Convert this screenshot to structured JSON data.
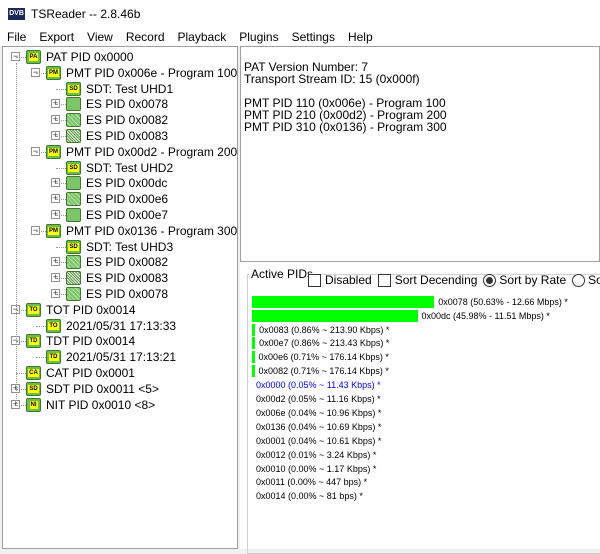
{
  "window": {
    "title": "TSReader -- 2.8.46b",
    "logo": "DVB"
  },
  "menu": [
    "File",
    "Export",
    "View",
    "Record",
    "Playback",
    "Plugins",
    "Settings",
    "Help"
  ],
  "tree": [
    {
      "label": "PAT PID 0x0000",
      "level": 0,
      "exp": "-",
      "icon": "PAT"
    },
    {
      "label": "PMT PID 0x006e - Program 100",
      "level": 1,
      "exp": "-",
      "icon": "PMT"
    },
    {
      "label": "SDT: Test UHD1",
      "level": 2,
      "exp": "",
      "icon": "SDT"
    },
    {
      "label": "ES PID 0x0078",
      "level": 2,
      "exp": "+",
      "icon": "es1"
    },
    {
      "label": "ES PID 0x0082",
      "level": 2,
      "exp": "+",
      "icon": "es2"
    },
    {
      "label": "ES PID 0x0083",
      "level": 2,
      "exp": "+",
      "icon": "es3"
    },
    {
      "label": "PMT PID 0x00d2 - Program 200",
      "level": 1,
      "exp": "-",
      "icon": "PMT"
    },
    {
      "label": "SDT: Test UHD2",
      "level": 2,
      "exp": "",
      "icon": "SDT"
    },
    {
      "label": "ES PID 0x00dc",
      "level": 2,
      "exp": "+",
      "icon": "es1"
    },
    {
      "label": "ES PID 0x00e6",
      "level": 2,
      "exp": "+",
      "icon": "es2"
    },
    {
      "label": "ES PID 0x00e7",
      "level": 2,
      "exp": "+",
      "icon": "es1"
    },
    {
      "label": "PMT PID 0x0136 - Program 300",
      "level": 1,
      "exp": "-",
      "icon": "PMT"
    },
    {
      "label": "SDT: Test UHD3",
      "level": 2,
      "exp": "",
      "icon": "SDT"
    },
    {
      "label": "ES PID 0x0082",
      "level": 2,
      "exp": "+",
      "icon": "es2"
    },
    {
      "label": "ES PID 0x0083",
      "level": 2,
      "exp": "+",
      "icon": "es3"
    },
    {
      "label": "ES PID 0x0078",
      "level": 2,
      "exp": "+",
      "icon": "es2"
    },
    {
      "label": "TOT PID 0x0014",
      "level": 0,
      "exp": "-",
      "icon": "TOT"
    },
    {
      "label": "2021/05/31 17:13:33",
      "level": 1,
      "exp": "",
      "icon": "TOT"
    },
    {
      "label": "TDT PID 0x0014",
      "level": 0,
      "exp": "-",
      "icon": "TDT"
    },
    {
      "label": "2021/05/31 17:13:21",
      "level": 1,
      "exp": "",
      "icon": "TDT"
    },
    {
      "label": "CAT PID 0x0001",
      "level": 0,
      "exp": "",
      "icon": "CAT"
    },
    {
      "label": "SDT PID 0x0011 <5>",
      "level": 0,
      "exp": "+",
      "icon": "SDT"
    },
    {
      "label": "NIT PID 0x0010 <8>",
      "level": 0,
      "exp": "+",
      "icon": "NIT"
    }
  ],
  "info": {
    "lines": [
      "PAT Version Number: 7",
      "Transport Stream ID: 15 (0x000f)",
      "",
      "PMT PID 110 (0x006e) - Program 100",
      "PMT PID 210 (0x00d2) - Program 200",
      "PMT PID 310 (0x0136) - Program 300"
    ]
  },
  "active_pids": {
    "label": "Active PIDs",
    "disabled_label": "Disabled",
    "disabled": false,
    "sort_desc_label": "Sort Decending",
    "sort_desc": false,
    "sort_rate_label": "Sort by Rate",
    "sort_rate": true,
    "sort_other_label": "Sort by",
    "bar_color": "#00ff00",
    "highlight_color": "#0000ff",
    "items": [
      {
        "text": "0x0078 (50.63% - 12.66 Mbps) *",
        "pct": 50.63
      },
      {
        "text": "0x00dc (45.98% - 11.51 Mbps) *",
        "pct": 45.98
      },
      {
        "text": "0x0083 (0.86% ~ 213.90 Kbps) *",
        "pct": 0.86
      },
      {
        "text": "0x00e7 (0.86% ~ 213.43 Kbps) *",
        "pct": 0.86
      },
      {
        "text": "0x00e6 (0.71% ~ 176.14 Kbps) *",
        "pct": 0.71
      },
      {
        "text": "0x0082 (0.71% ~ 176.14 Kbps) *",
        "pct": 0.71
      },
      {
        "text": "0x0000 (0.05% ~ 11.43 Kbps) *",
        "pct": 0.05,
        "highlight": true
      },
      {
        "text": "0x00d2 (0.05% ~ 11.16 Kbps) *",
        "pct": 0.05
      },
      {
        "text": "0x006e (0.04% ~ 10.96 Kbps) *",
        "pct": 0.04
      },
      {
        "text": "0x0136 (0.04% ~ 10.69 Kbps) *",
        "pct": 0.04
      },
      {
        "text": "0x0001 (0.04% ~ 10.61 Kbps) *",
        "pct": 0.04
      },
      {
        "text": "0x0012 (0.01% ~ 3.24 Kbps) *",
        "pct": 0.01
      },
      {
        "text": "0x0010 (0.00% ~ 1.17 Kbps) *",
        "pct": 0.0
      },
      {
        "text": "0x0011 (0.00% ~ 447 bps) *",
        "pct": 0.0
      },
      {
        "text": "0x0014 (0.00% ~ 81 bps) *",
        "pct": 0.0
      }
    ]
  }
}
